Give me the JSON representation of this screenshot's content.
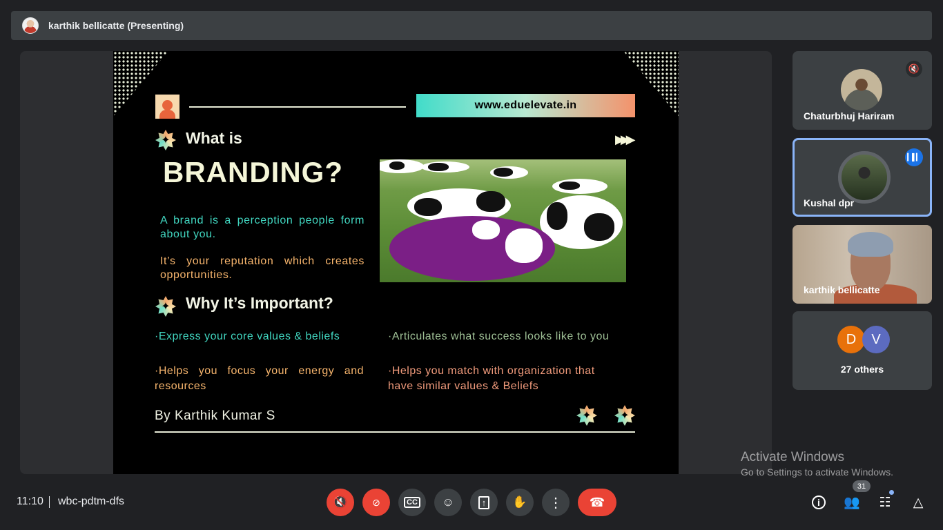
{
  "topbar": {
    "presenter_title": "karthik bellicatte (Presenting)"
  },
  "slide": {
    "url": "www.eduelevate.in",
    "heading_what": "What is",
    "heading_branding": "BRANDING?",
    "para_perception": "A brand is a perception people form about you.",
    "para_reputation": "It’s your reputation which creates opportunities.",
    "heading_why": "Why It’s Important?",
    "bullet_values": "·Express your core values & beliefs",
    "bullet_success": "·Articulates what success looks like to you",
    "bullet_focus": "·Helps you focus your energy and resources",
    "bullet_match": "·Helps you match with organization that have similar values & Beliefs",
    "author": "By Karthik Kumar S"
  },
  "participants": {
    "tile1_name": "Chaturbhuj Hariram",
    "tile2_name": "Kushal dpr",
    "tile3_name": "karthik bellicatte",
    "others_initial_1": "D",
    "others_initial_2": "V",
    "others_label": "27 others",
    "avatar_colors": {
      "D": "#e8710a",
      "V": "#5c6bc0"
    }
  },
  "watermark": {
    "line1": "Activate Windows",
    "line2": "Go to Settings to activate Windows."
  },
  "bottombar": {
    "time": "11:10",
    "meeting_code": "wbc-pdtm-dfs",
    "people_count": "31",
    "controls": [
      "mic-off-icon",
      "camera-off-icon",
      "captions-icon",
      "emoji-icon",
      "present-icon",
      "raise-hand-icon",
      "more-icon",
      "hangup-icon"
    ],
    "right_controls": [
      "info-icon",
      "people-icon",
      "chat-icon",
      "activities-icon"
    ]
  },
  "colors": {
    "accent_red": "#ea4335",
    "accent_blue": "#8ab4f8",
    "background": "#202124",
    "teal": "#41d6c0",
    "orange": "#f7b56d"
  }
}
